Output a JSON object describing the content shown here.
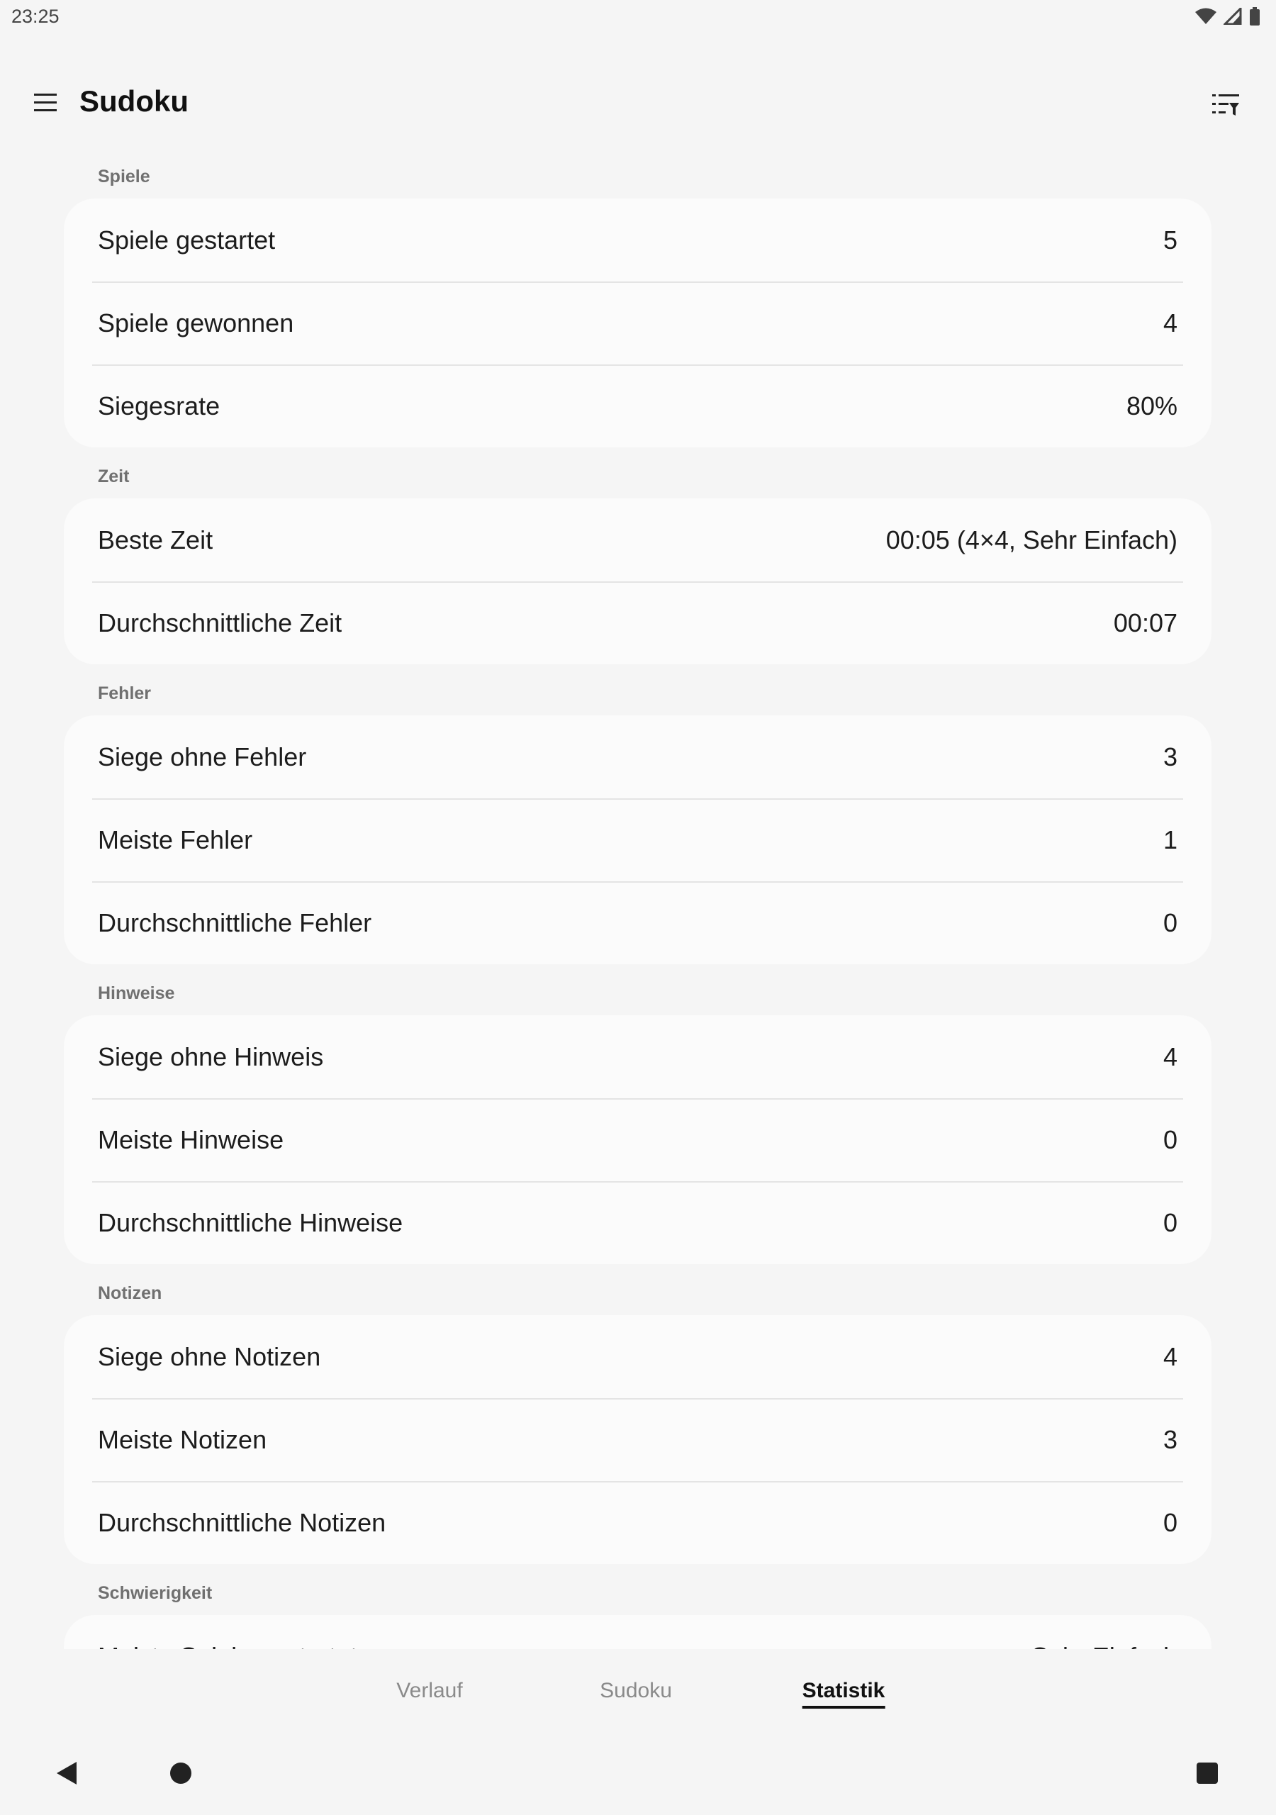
{
  "status_bar": {
    "time": "23:25",
    "icons": [
      "wifi-icon",
      "signal-icon",
      "battery-icon"
    ]
  },
  "app_bar": {
    "title": "Sudoku",
    "menu_icon": "hamburger-menu-icon",
    "filter_icon": "filter-list-icon"
  },
  "sections": {
    "games": {
      "header": "Spiele",
      "rows": [
        {
          "label": "Spiele gestartet",
          "value": "5"
        },
        {
          "label": "Spiele gewonnen",
          "value": "4"
        },
        {
          "label": "Siegesrate",
          "value": "80%"
        }
      ]
    },
    "time": {
      "header": "Zeit",
      "rows": [
        {
          "label": "Beste Zeit",
          "value": "00:05 (4×4, Sehr Einfach)"
        },
        {
          "label": "Durchschnittliche Zeit",
          "value": "00:07"
        }
      ]
    },
    "mistakes": {
      "header": "Fehler",
      "rows": [
        {
          "label": "Siege ohne Fehler",
          "value": "3"
        },
        {
          "label": "Meiste Fehler",
          "value": "1"
        },
        {
          "label": "Durchschnittliche Fehler",
          "value": "0"
        }
      ]
    },
    "hints": {
      "header": "Hinweise",
      "rows": [
        {
          "label": "Siege ohne Hinweis",
          "value": "4"
        },
        {
          "label": "Meiste Hinweise",
          "value": "0"
        },
        {
          "label": "Durchschnittliche Hinweise",
          "value": "0"
        }
      ]
    },
    "notes": {
      "header": "Notizen",
      "rows": [
        {
          "label": "Siege ohne Notizen",
          "value": "4"
        },
        {
          "label": "Meiste Notizen",
          "value": "3"
        },
        {
          "label": "Durchschnittliche Notizen",
          "value": "0"
        }
      ]
    },
    "difficulty": {
      "header": "Schwierigkeit",
      "rows": [
        {
          "label": "Meiste Spiele gestartet",
          "value": "Sehr Einfach"
        }
      ]
    }
  },
  "tabs": [
    {
      "label": "Verlauf",
      "active": false
    },
    {
      "label": "Sudoku",
      "active": false
    },
    {
      "label": "Statistik",
      "active": true
    }
  ],
  "nav_bar": {
    "back_icon": "back-triangle-icon",
    "home_icon": "home-circle-icon",
    "recents_icon": "recents-square-icon"
  }
}
